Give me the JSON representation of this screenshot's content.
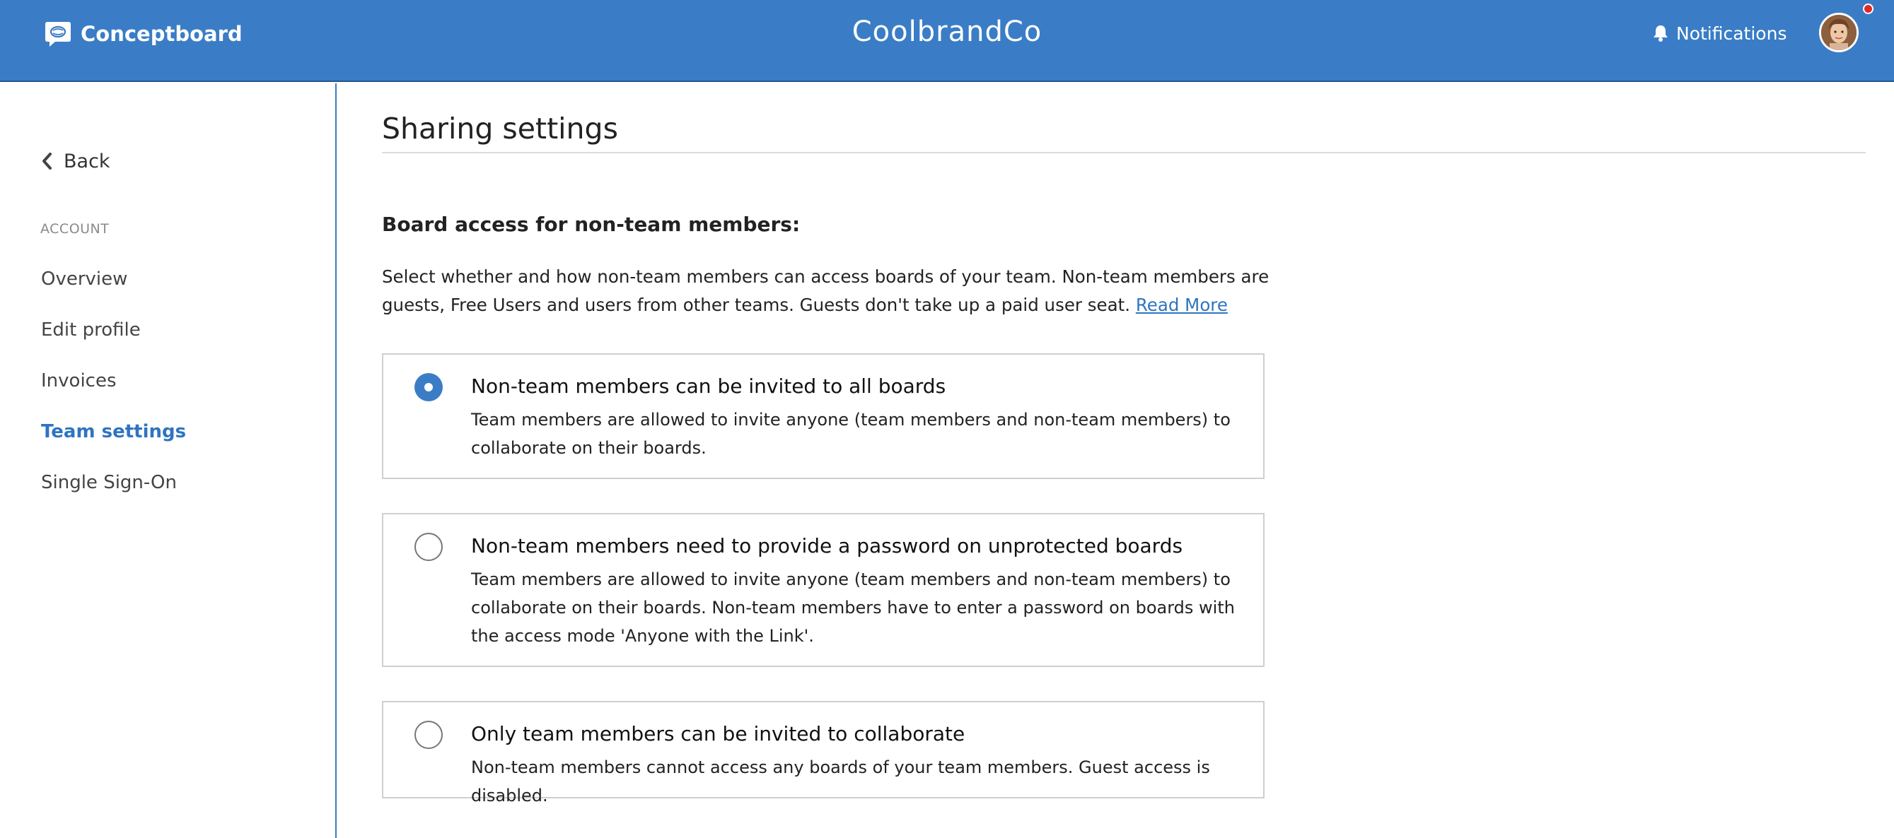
{
  "header": {
    "logo_text": "Conceptboard",
    "team_name": "CoolbrandCo",
    "notifications_label": "Notifications",
    "has_unread_notifications": true
  },
  "sidebar": {
    "back_label": "Back",
    "section_label": "ACCOUNT",
    "items": [
      {
        "label": "Overview",
        "active": false
      },
      {
        "label": "Edit profile",
        "active": false
      },
      {
        "label": "Invoices",
        "active": false
      },
      {
        "label": "Team settings",
        "active": true
      },
      {
        "label": "Single Sign-On",
        "active": false
      }
    ]
  },
  "main": {
    "page_title": "Sharing settings",
    "section_title": "Board access for non-team members:",
    "description": "Select whether and how non-team members can access boards of your team. Non-team members are guests, Free Users and users from other teams. Guests don't take up a paid user seat.",
    "read_more_label": "Read More",
    "options": [
      {
        "title": "Non-team members can be invited to all boards",
        "description": "Team members are allowed to invite anyone (team members and non-team members) to collaborate on their boards.",
        "selected": true
      },
      {
        "title": "Non-team members need to provide a password on unprotected boards",
        "description": "Team members are allowed to invite anyone (team members and non-team members) to collaborate on their boards. Non-team members have to enter a password on boards with the access mode 'Anyone with the Link'.",
        "selected": false
      },
      {
        "title": "Only team members can be invited to collaborate",
        "description": "Non-team members cannot access any boards of your team members. Guest access is disabled.",
        "selected": false
      }
    ]
  },
  "colors": {
    "brand_blue": "#3a7dc6",
    "active_link": "#2f74c0",
    "notification_dot": "#e02828"
  }
}
